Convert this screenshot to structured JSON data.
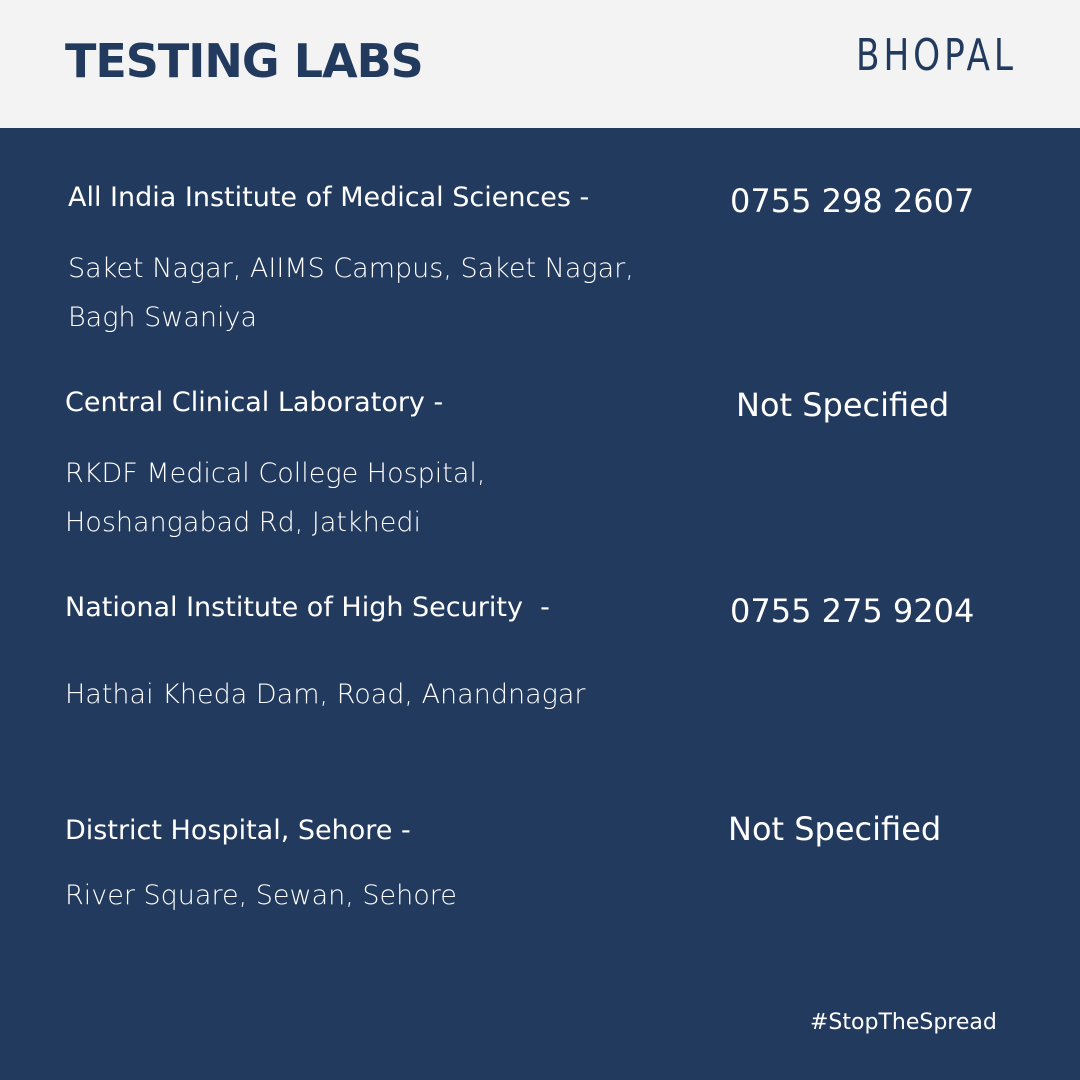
{
  "header": {
    "title": "TESTING LABS",
    "city": "BHOPAL"
  },
  "labs": [
    {
      "name": "All India Institute of Medical Sciences -",
      "address_lines": [
        "Saket Nagar, AIIMS Campus, Saket Nagar,",
        "Bagh Swaniya"
      ],
      "phone": "0755 298 2607"
    },
    {
      "name": "Central Clinical Laboratory -",
      "address_lines": [
        "RKDF Medical College Hospital,",
        "Hoshangabad Rd, Jatkhedi"
      ],
      "phone": "Not Specified"
    },
    {
      "name": "National Institute of High Security  -",
      "address_lines": [
        "Hathai Kheda Dam, Road, Anandnagar"
      ],
      "phone": "0755 275 9204"
    },
    {
      "name": "District Hospital, Sehore -",
      "address_lines": [
        "River Square, Sewan, Sehore"
      ],
      "phone": "Not Specified"
    }
  ],
  "footer": {
    "hashtag": "#StopTheSpread"
  },
  "colors": {
    "navy": "#233a5f",
    "header_bg": "#f3f3f3",
    "text_light": "#ffffff"
  }
}
